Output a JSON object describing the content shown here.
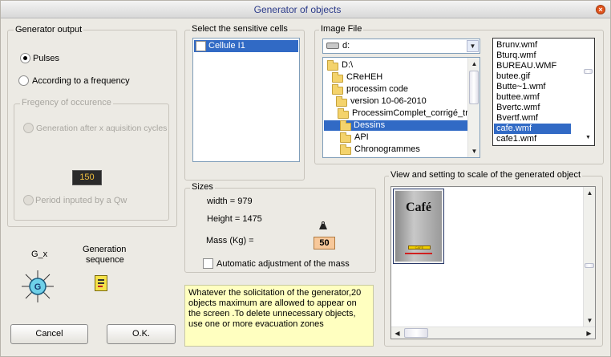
{
  "window": {
    "title": "Generator of objects"
  },
  "generator_output": {
    "title": "Generator output",
    "pulses": "Pulses",
    "frequency": "According to a frequency",
    "freq_group": {
      "title": "Fregency of occurence",
      "after_cycles": "Generation after x aquisition cycles",
      "value": "150",
      "period": "Period inputed by a Qw"
    }
  },
  "gx": {
    "label": "G_x",
    "icon_letter": "G"
  },
  "gen_seq": {
    "label_line1": "Generation",
    "label_line2": "sequence"
  },
  "buttons": {
    "cancel": "Cancel",
    "ok": "O.K."
  },
  "sensitive_cells": {
    "title": "Select the sensitive cells",
    "items": [
      "Cellule I1"
    ]
  },
  "image_file": {
    "title": "Image File",
    "drive": "d:",
    "folders": [
      "D:\\",
      "CReHEH",
      "processim code",
      "version 10-06-2010",
      "ProcessimComplet_corrigé_trad",
      "Dessins",
      "API",
      "Chronogrammes"
    ],
    "files": [
      "Brunv.wmf",
      "Bturq.wmf",
      "BUREAU.WMF",
      "butee.gif",
      "Butte~1.wmf",
      "buttee.wmf",
      "Bvertc.wmf",
      "Bvertf.wmf",
      "cafe.wmf",
      "cafe1.wmf"
    ],
    "selected_file": "cafe.wmf"
  },
  "sizes": {
    "title": "Sizes",
    "width": "width = 979",
    "height": "Height = 1475",
    "mass_label": "Mass (Kg) =",
    "mass_value": "50",
    "auto_mass": "Automatic adjustment of the mass"
  },
  "note": "Whatever the solicitation of the generator,20 objects maximum are allowed to appear on the screen .To delete unnecessary objects, use one or more evacuation zones",
  "preview": {
    "title": "View and setting to scale of the generated object",
    "object_text": "Café",
    "label_text": "CAFÉ"
  }
}
